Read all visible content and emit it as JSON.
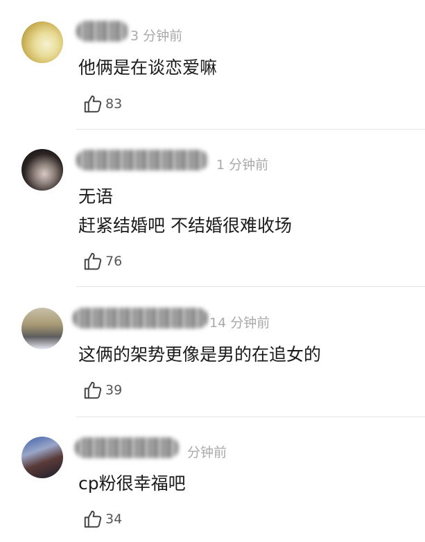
{
  "comments": [
    {
      "time": "3 分钟前",
      "lines": [
        "他俩是在谈恋爱嘛"
      ],
      "likes": "83"
    },
    {
      "time": "1 分钟前",
      "lines": [
        "无语",
        "赶紧结婚吧 不结婚很难收场"
      ],
      "likes": "76"
    },
    {
      "time": "14 分钟前",
      "lines": [
        "这俩的架势更像是男的在追女的"
      ],
      "likes": "39"
    },
    {
      "time": "分钟前",
      "lines": [
        "cp粉很幸福吧"
      ],
      "likes": "34"
    }
  ],
  "icons": {
    "like": "thumbs-up-outline-icon"
  }
}
